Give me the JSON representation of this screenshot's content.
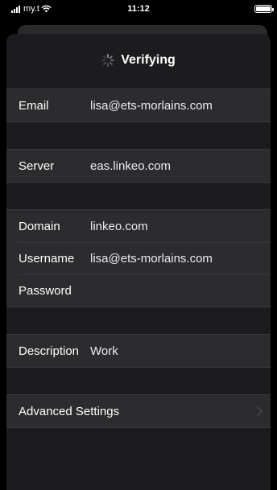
{
  "status_bar": {
    "carrier": "my.t",
    "time": "11:12"
  },
  "nav": {
    "title": "Verifying"
  },
  "sections": {
    "email": {
      "label": "Email",
      "value": "lisa@ets-morlains.com"
    },
    "server": {
      "label": "Server",
      "value": "eas.linkeo.com"
    },
    "domain": {
      "label": "Domain",
      "value": "linkeo.com"
    },
    "username": {
      "label": "Username",
      "value": "lisa@ets-morlains.com"
    },
    "password": {
      "label": "Password",
      "value": ""
    },
    "description": {
      "label": "Description",
      "value": "Work"
    },
    "advanced": {
      "label": "Advanced Settings"
    }
  },
  "icons": {
    "signal": "signal-bars-icon",
    "wifi": "wifi-icon",
    "battery": "battery-icon",
    "spinner": "activity-spinner-icon",
    "chevron": "chevron-right-icon"
  }
}
